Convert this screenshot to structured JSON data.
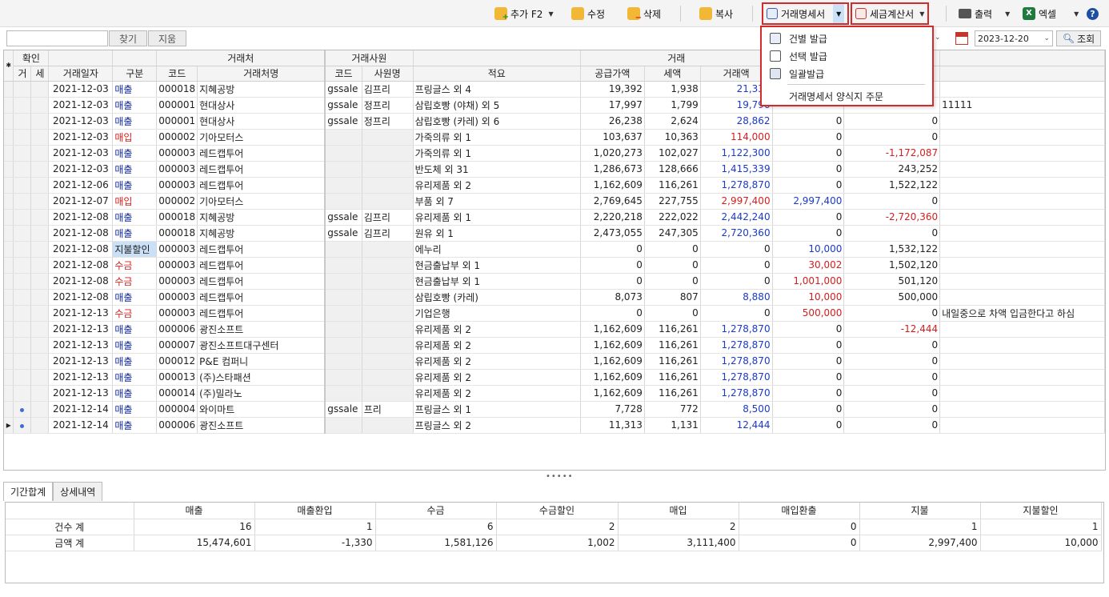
{
  "toolbar": {
    "add": "추가 F2",
    "edit": "수정",
    "delete": "삭제",
    "copy": "복사",
    "invoice": "거래명세서",
    "tax_invoice": "세금계산서",
    "print": "출력",
    "excel": "엑셀",
    "help": "?"
  },
  "search": {
    "value": "",
    "find_label": "찾기",
    "clear_label": "지움",
    "date_to": "2023-12-20",
    "query_label": "조회"
  },
  "invoice_menu": {
    "items": [
      "건별 발급",
      "선택 발급",
      "일괄발급"
    ],
    "order_label": "거래명세서 양식지 주문"
  },
  "grid": {
    "group_headers": {
      "confirm": "확인",
      "partner": "거래처",
      "employee": "거래사원",
      "trade": "거래"
    },
    "columns": [
      "거",
      "세",
      "거래일자",
      "구분",
      "코드",
      "거래처명",
      "코드",
      "사원명",
      "적요",
      "공급가액",
      "세액",
      "거래액",
      "",
      "",
      ""
    ],
    "rows": [
      {
        "ind": "",
        "g": "",
        "s": "",
        "date": "2021-12-03",
        "type": "매출",
        "code": "000018",
        "name": "지혜공방",
        "ecode": "gssale",
        "ename": "김프리",
        "memo": "프링글스 외 4",
        "supply": "19,392",
        "tax": "1,938",
        "amount": "21,330",
        "c1": "",
        "c2": "",
        "note": ""
      },
      {
        "ind": "",
        "g": "",
        "s": "",
        "date": "2021-12-03",
        "type": "매출",
        "code": "000001",
        "name": "현대상사",
        "ecode": "gssale",
        "ename": "정프리",
        "memo": "삼립호빵 (야채) 외 5",
        "supply": "17,997",
        "tax": "1,799",
        "amount": "19,796",
        "c1": "",
        "c2": "",
        "note": "11111"
      },
      {
        "ind": "",
        "g": "",
        "s": "",
        "date": "2021-12-03",
        "type": "매출",
        "code": "000001",
        "name": "현대상사",
        "ecode": "gssale",
        "ename": "정프리",
        "memo": "삼립호빵 (카레) 외 6",
        "supply": "26,238",
        "tax": "2,624",
        "amount": "28,862",
        "c1": "0",
        "c2": "0",
        "note": ""
      },
      {
        "ind": "",
        "g": "",
        "s": "",
        "date": "2021-12-03",
        "type": "매입",
        "code": "000002",
        "name": "기아모터스",
        "ecode": "",
        "ename": "",
        "memo": "가죽의류 외 1",
        "supply": "103,637",
        "tax": "10,363",
        "amount": "114,000",
        "c1": "0",
        "c2": "0",
        "note": ""
      },
      {
        "ind": "",
        "g": "",
        "s": "",
        "date": "2021-12-03",
        "type": "매출",
        "code": "000003",
        "name": "레드캡투어",
        "ecode": "",
        "ename": "",
        "memo": "가죽의류 외 1",
        "supply": "1,020,273",
        "tax": "102,027",
        "amount": "1,122,300",
        "c1": "0",
        "c2": "-1,172,087",
        "note": ""
      },
      {
        "ind": "",
        "g": "",
        "s": "",
        "date": "2021-12-03",
        "type": "매출",
        "code": "000003",
        "name": "레드캡투어",
        "ecode": "",
        "ename": "",
        "memo": "반도체 외 31",
        "supply": "1,286,673",
        "tax": "128,666",
        "amount": "1,415,339",
        "c1": "0",
        "c2": "243,252",
        "note": ""
      },
      {
        "ind": "",
        "g": "",
        "s": "",
        "date": "2021-12-06",
        "type": "매출",
        "code": "000003",
        "name": "레드캡투어",
        "ecode": "",
        "ename": "",
        "memo": "유리제품 외 2",
        "supply": "1,162,609",
        "tax": "116,261",
        "amount": "1,278,870",
        "c1": "0",
        "c2": "1,522,122",
        "note": ""
      },
      {
        "ind": "",
        "g": "",
        "s": "",
        "date": "2021-12-07",
        "type": "매입",
        "code": "000002",
        "name": "기아모터스",
        "ecode": "",
        "ename": "",
        "memo": "부품 외 7",
        "supply": "2,769,645",
        "tax": "227,755",
        "amount": "2,997,400",
        "c1": "2,997,400",
        "c2": "0",
        "note": ""
      },
      {
        "ind": "",
        "g": "",
        "s": "",
        "date": "2021-12-08",
        "type": "매출",
        "code": "000018",
        "name": "지혜공방",
        "ecode": "gssale",
        "ename": "김프리",
        "memo": "유리제품 외 1",
        "supply": "2,220,218",
        "tax": "222,022",
        "amount": "2,442,240",
        "c1": "0",
        "c2": "-2,720,360",
        "note": ""
      },
      {
        "ind": "",
        "g": "",
        "s": "",
        "date": "2021-12-08",
        "type": "매출",
        "code": "000018",
        "name": "지혜공방",
        "ecode": "gssale",
        "ename": "김프리",
        "memo": "원유 외 1",
        "supply": "2,473,055",
        "tax": "247,305",
        "amount": "2,720,360",
        "c1": "0",
        "c2": "0",
        "note": ""
      },
      {
        "ind": "",
        "g": "",
        "s": "",
        "date": "2021-12-08",
        "type": "지불할인",
        "code": "000003",
        "name": "레드캡투어",
        "ecode": "",
        "ename": "",
        "memo": "에누리",
        "supply": "0",
        "tax": "0",
        "amount": "0",
        "c1": "10,000",
        "c2": "1,532,122",
        "note": ""
      },
      {
        "ind": "",
        "g": "",
        "s": "",
        "date": "2021-12-08",
        "type": "수금",
        "code": "000003",
        "name": "레드캡투어",
        "ecode": "",
        "ename": "",
        "memo": "현금출납부 외 1",
        "supply": "0",
        "tax": "0",
        "amount": "0",
        "c1": "30,002",
        "c2": "1,502,120",
        "note": ""
      },
      {
        "ind": "",
        "g": "",
        "s": "",
        "date": "2021-12-08",
        "type": "수금",
        "code": "000003",
        "name": "레드캡투어",
        "ecode": "",
        "ename": "",
        "memo": "현금출납부 외 1",
        "supply": "0",
        "tax": "0",
        "amount": "0",
        "c1": "1,001,000",
        "c2": "501,120",
        "note": ""
      },
      {
        "ind": "",
        "g": "",
        "s": "",
        "date": "2021-12-08",
        "type": "매출",
        "code": "000003",
        "name": "레드캡투어",
        "ecode": "",
        "ename": "",
        "memo": "삼립호빵 (카레)",
        "supply": "8,073",
        "tax": "807",
        "amount": "8,880",
        "c1": "10,000",
        "c2": "500,000",
        "note": ""
      },
      {
        "ind": "",
        "g": "",
        "s": "",
        "date": "2021-12-13",
        "type": "수금",
        "code": "000003",
        "name": "레드캡투어",
        "ecode": "",
        "ename": "",
        "memo": "기업은행",
        "supply": "0",
        "tax": "0",
        "amount": "0",
        "c1": "500,000",
        "c2": "0",
        "note": "내일중으로 차액 입금한다고 하심"
      },
      {
        "ind": "",
        "g": "",
        "s": "",
        "date": "2021-12-13",
        "type": "매출",
        "code": "000006",
        "name": "광진소프트",
        "ecode": "",
        "ename": "",
        "memo": "유리제품 외 2",
        "supply": "1,162,609",
        "tax": "116,261",
        "amount": "1,278,870",
        "c1": "0",
        "c2": "-12,444",
        "note": ""
      },
      {
        "ind": "",
        "g": "",
        "s": "",
        "date": "2021-12-13",
        "type": "매출",
        "code": "000007",
        "name": "광진소프트대구센터",
        "ecode": "",
        "ename": "",
        "memo": "유리제품 외 2",
        "supply": "1,162,609",
        "tax": "116,261",
        "amount": "1,278,870",
        "c1": "0",
        "c2": "0",
        "note": ""
      },
      {
        "ind": "",
        "g": "",
        "s": "",
        "date": "2021-12-13",
        "type": "매출",
        "code": "000012",
        "name": "P&E 컴퍼니",
        "ecode": "",
        "ename": "",
        "memo": "유리제품 외 2",
        "supply": "1,162,609",
        "tax": "116,261",
        "amount": "1,278,870",
        "c1": "0",
        "c2": "0",
        "note": ""
      },
      {
        "ind": "",
        "g": "",
        "s": "",
        "date": "2021-12-13",
        "type": "매출",
        "code": "000013",
        "name": "(주)스타패션",
        "ecode": "",
        "ename": "",
        "memo": "유리제품 외 2",
        "supply": "1,162,609",
        "tax": "116,261",
        "amount": "1,278,870",
        "c1": "0",
        "c2": "0",
        "note": ""
      },
      {
        "ind": "",
        "g": "",
        "s": "",
        "date": "2021-12-13",
        "type": "매출",
        "code": "000014",
        "name": "(주)밀라노",
        "ecode": "",
        "ename": "",
        "memo": "유리제품 외 2",
        "supply": "1,162,609",
        "tax": "116,261",
        "amount": "1,278,870",
        "c1": "0",
        "c2": "0",
        "note": ""
      },
      {
        "ind": "",
        "g": "•",
        "s": "",
        "date": "2021-12-14",
        "type": "매출",
        "code": "000004",
        "name": "와이마트",
        "ecode": "gssale",
        "ename": "프리",
        "memo": "프링글스 외 1",
        "supply": "7,728",
        "tax": "772",
        "amount": "8,500",
        "c1": "0",
        "c2": "0",
        "note": ""
      },
      {
        "ind": "▸",
        "g": "•",
        "s": "",
        "date": "2021-12-14",
        "type": "매출",
        "code": "000006",
        "name": "광진소프트",
        "ecode": "",
        "ename": "",
        "memo": "프링글스 외 2",
        "supply": "11,313",
        "tax": "1,131",
        "amount": "12,444",
        "c1": "0",
        "c2": "0",
        "note": ""
      }
    ]
  },
  "splitter": "•••••",
  "tabs": [
    "기간합계",
    "상세내역"
  ],
  "summary": {
    "headers": [
      "매출",
      "매출환입",
      "수금",
      "수금할인",
      "매입",
      "매입환출",
      "지불",
      "지불할인"
    ],
    "rows": [
      {
        "label": "건수 계",
        "values": [
          "16",
          "1",
          "6",
          "2",
          "2",
          "0",
          "1",
          "1"
        ]
      },
      {
        "label": "금액 계",
        "values": [
          "15,474,601",
          "-1,330",
          "1,581,126",
          "1,002",
          "3,111,400",
          "0",
          "2,997,400",
          "10,000"
        ]
      }
    ]
  },
  "colors": {
    "sale": "#1a3ac8",
    "purchase": "#d41e1e",
    "highlight": "#d32b2b",
    "selected": "#c9e0f7"
  }
}
